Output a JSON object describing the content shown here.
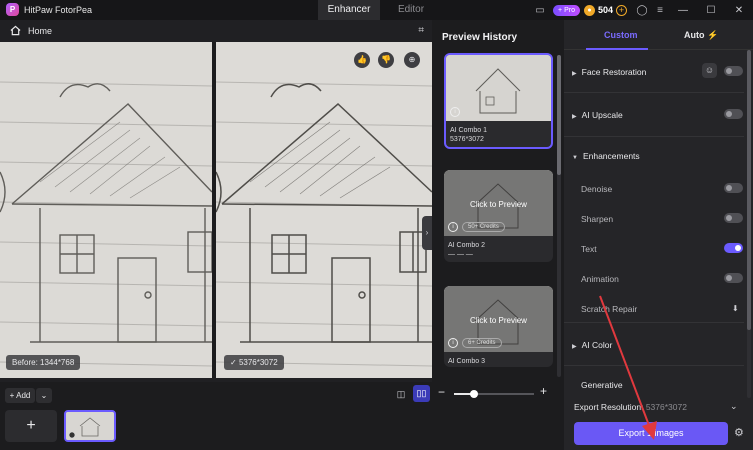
{
  "app": {
    "title": "HitPaw FotorPea",
    "tabs": [
      {
        "label": "Enhancer",
        "active": true
      },
      {
        "label": "Editor",
        "active": false
      }
    ],
    "pro_badge": "+ Pro",
    "credits": "504"
  },
  "editor": {
    "home_label": "Home",
    "before_tag": "Before: 1344*768",
    "after_tag": "5376*3072"
  },
  "bottom": {
    "add_label": "+ Add"
  },
  "history": {
    "title": "Preview History",
    "cards": [
      {
        "name": "AI Combo 1",
        "resolution": "5376*3072",
        "selected": true
      },
      {
        "name": "AI Combo 2",
        "resolution": "— — —",
        "overlay": "Click to Preview",
        "credits": "50+ Credits"
      },
      {
        "name": "AI Combo 3",
        "overlay": "Click to Preview",
        "credits": "6+ Credits"
      }
    ]
  },
  "panel": {
    "tabs": {
      "custom": "Custom",
      "auto": "Auto"
    },
    "sections": {
      "face_restoration": {
        "label": "Face Restoration",
        "enabled": false
      },
      "ai_upscale": {
        "label": "AI Upscale",
        "enabled": false
      },
      "enhancements": {
        "label": "Enhancements",
        "items": [
          {
            "label": "Denoise",
            "enabled": false
          },
          {
            "label": "Sharpen",
            "enabled": false
          },
          {
            "label": "Text",
            "enabled": true
          },
          {
            "label": "Animation",
            "enabled": false
          },
          {
            "label": "Scratch Repair"
          }
        ]
      },
      "ai_color": {
        "label": "AI Color"
      },
      "generative": {
        "label": "Generative"
      }
    },
    "export_resolution_label": "Export Resolution:",
    "export_resolution_value": "5376*3072",
    "export_button": "Export 1 images"
  },
  "zoom": {
    "level_fraction": 0.25
  },
  "colors": {
    "accent": "#6b5bff",
    "annotation": "#e0393e"
  }
}
